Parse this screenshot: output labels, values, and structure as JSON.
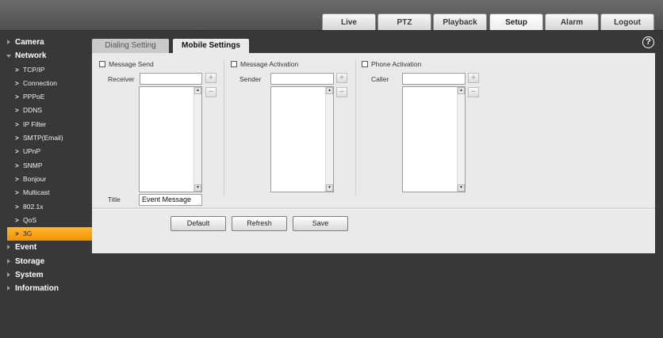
{
  "nav": {
    "tabs": [
      {
        "label": "Live"
      },
      {
        "label": "PTZ"
      },
      {
        "label": "Playback"
      },
      {
        "label": "Setup"
      },
      {
        "label": "Alarm"
      },
      {
        "label": "Logout"
      }
    ],
    "active": "Setup"
  },
  "sidebar": {
    "camera": "Camera",
    "network": "Network",
    "network_items": [
      "TCP/IP",
      "Connection",
      "PPPoE",
      "DDNS",
      "IP Filter",
      "SMTP(Email)",
      "UPnP",
      "SNMP",
      "Bonjour",
      "Multicast",
      "802.1x",
      "QoS",
      "3G"
    ],
    "active_item": "3G",
    "event": "Event",
    "storage": "Storage",
    "system": "System",
    "information": "Information"
  },
  "subtabs": {
    "dialing": "Dialing Setting",
    "mobile": "Mobile Settings",
    "active": "Mobile Settings"
  },
  "help_icon": "?",
  "message_send": {
    "label": "Message Send",
    "checked": false,
    "receiver_label": "Receiver",
    "receiver_value": "",
    "title_label": "Title",
    "title_value": "Event Message"
  },
  "message_activation": {
    "label": "Message Activation",
    "checked": false,
    "sender_label": "Sender",
    "sender_value": ""
  },
  "phone_activation": {
    "label": "Phone Activation",
    "checked": false,
    "caller_label": "Caller",
    "caller_value": ""
  },
  "buttons": {
    "add": "+",
    "remove": "−",
    "scroll_up": "▲",
    "scroll_down": "▼",
    "default": "Default",
    "refresh": "Refresh",
    "save": "Save"
  },
  "colors": {
    "background": "#383838",
    "panel": "#eaeaea",
    "active_item": "#f7a21b"
  }
}
